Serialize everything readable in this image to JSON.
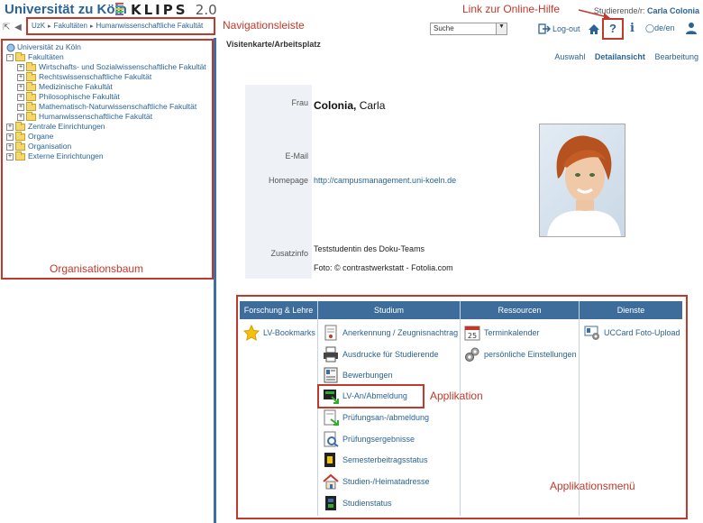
{
  "header": {
    "uni_title": "Universität zu Köln",
    "app_name": "KLIPS",
    "app_version": "2.0",
    "user_label": "Studierende/r:",
    "user_name": "Carla Colonia"
  },
  "breadcrumb": [
    "UzK",
    "Fakultäten",
    "Humanwissenschaftliche Fakultät"
  ],
  "search": {
    "selected": "Suche"
  },
  "top_actions": {
    "logout": "Log-out",
    "help": "?",
    "info": "i",
    "lang": "de/en"
  },
  "annotations": {
    "help_link": "Link zur Online-Hilfe",
    "nav_bar": "Navigationsleiste",
    "org_tree": "Organisationsbaum",
    "application": "Applikation",
    "app_menu": "Applikationsmenü"
  },
  "tree": {
    "root": "Universität zu Köln",
    "items": [
      {
        "label": "Fakultäten",
        "level": 0,
        "sign": "-"
      },
      {
        "label": "Wirtschafts- und Sozialwissenschaftliche Fakultät",
        "level": 1,
        "sign": "+"
      },
      {
        "label": "Rechtswissenschaftliche Fakultät",
        "level": 1,
        "sign": "+"
      },
      {
        "label": "Medizinische Fakultät",
        "level": 1,
        "sign": "+"
      },
      {
        "label": "Philosophische Fakultät",
        "level": 1,
        "sign": "+"
      },
      {
        "label": "Mathematisch-Naturwissenschaftliche Fakultät",
        "level": 1,
        "sign": "+"
      },
      {
        "label": "Humanwissenschaftliche Fakultät",
        "level": 1,
        "sign": "+"
      },
      {
        "label": "Zentrale Einrichtungen",
        "level": 0,
        "sign": "+"
      },
      {
        "label": "Organe",
        "level": 0,
        "sign": "+"
      },
      {
        "label": "Organisation",
        "level": 0,
        "sign": "+"
      },
      {
        "label": "Externe Einrichtungen",
        "level": 0,
        "sign": "+"
      }
    ]
  },
  "main": {
    "title": "Visitenkarte/Arbeitsplatz",
    "tabs": [
      "Auswahl",
      "Detailansicht",
      "Bearbeitung"
    ],
    "active_tab": "Detailansicht"
  },
  "card": {
    "salutation_label": "Frau",
    "last_name": "Colonia,",
    "first_name": "Carla",
    "email_label": "E-Mail",
    "homepage_label": "Homepage",
    "homepage": "http://campusmanagement.uni-koeln.de",
    "zusatz_label": "Zusatzinfo",
    "zusatz_line1": "Teststudentin des Doku-Teams",
    "zusatz_line2": "Foto: © contrastwerkstatt - Fotolia.com"
  },
  "apps": {
    "headers": [
      "Forschung & Lehre",
      "Studium",
      "Ressourcen",
      "Dienste"
    ],
    "forschung": [
      {
        "label": "LV-Bookmarks",
        "icon": "star-icon"
      }
    ],
    "studium": [
      {
        "label": "Anerkennung / Zeugnisnachtrag",
        "icon": "document-icon"
      },
      {
        "label": "Ausdrucke für Studierende",
        "icon": "printer-icon"
      },
      {
        "label": "Bewerbungen",
        "icon": "form-icon"
      },
      {
        "label": "LV-An/Abmeldung",
        "icon": "registration-icon"
      },
      {
        "label": "Prüfungsan-/abmeldung",
        "icon": "exam-icon"
      },
      {
        "label": "Prüfungsergebnisse",
        "icon": "results-icon"
      },
      {
        "label": "Semesterbeitragsstatus",
        "icon": "fee-icon"
      },
      {
        "label": "Studien-/Heimatadresse",
        "icon": "house-icon"
      },
      {
        "label": "Studienstatus",
        "icon": "status-icon"
      }
    ],
    "ressourcen": [
      {
        "label": "Terminkalender",
        "icon": "calendar-icon"
      },
      {
        "label": "persönliche Einstellungen",
        "icon": "gears-icon"
      }
    ],
    "dienste": [
      {
        "label": "UCCard Foto-Upload",
        "icon": "card-upload-icon"
      }
    ]
  },
  "colors": {
    "accent": "#2a6496",
    "header_bar": "#3e6d9c",
    "annotation": "#c0392b",
    "sidebar_border": "#3b6fa8"
  }
}
